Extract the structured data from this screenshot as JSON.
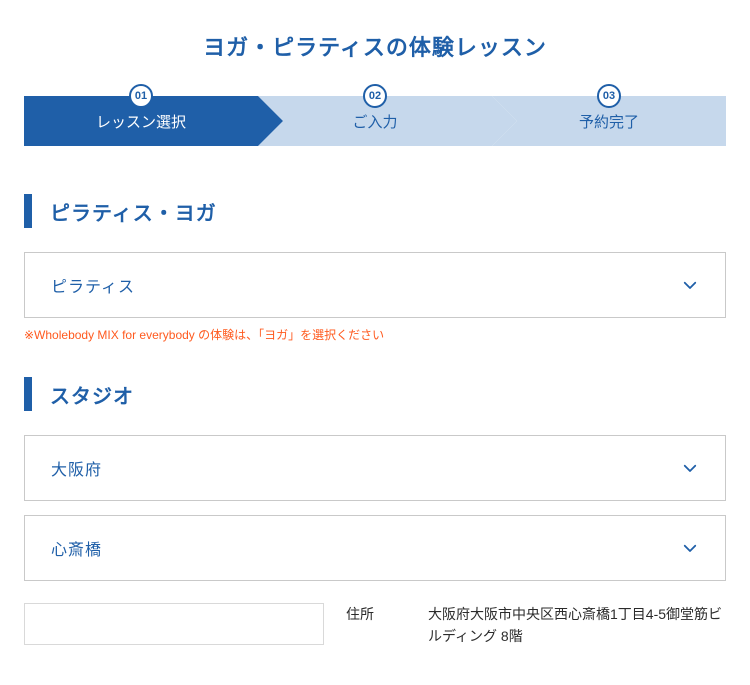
{
  "page_title": "ヨガ・ピラティスの体験レッスン",
  "stepper": [
    {
      "num": "01",
      "label": "レッスン選択",
      "active": true
    },
    {
      "num": "02",
      "label": "ご入力",
      "active": false
    },
    {
      "num": "03",
      "label": "予約完了",
      "active": false
    }
  ],
  "sections": {
    "category": {
      "title": "ピラティス・ヨガ",
      "select_value": "ピラティス",
      "note": "※Wholebody MIX for everybody の体験は、「ヨガ」を選択ください"
    },
    "studio": {
      "title": "スタジオ",
      "prefecture_value": "大阪府",
      "studio_value": "心斎橋",
      "detail": {
        "address_label": "住所",
        "address_value": "大阪府大阪市中央区西心斎橋1丁目4-5御堂筋ビルディング 8階"
      }
    }
  }
}
